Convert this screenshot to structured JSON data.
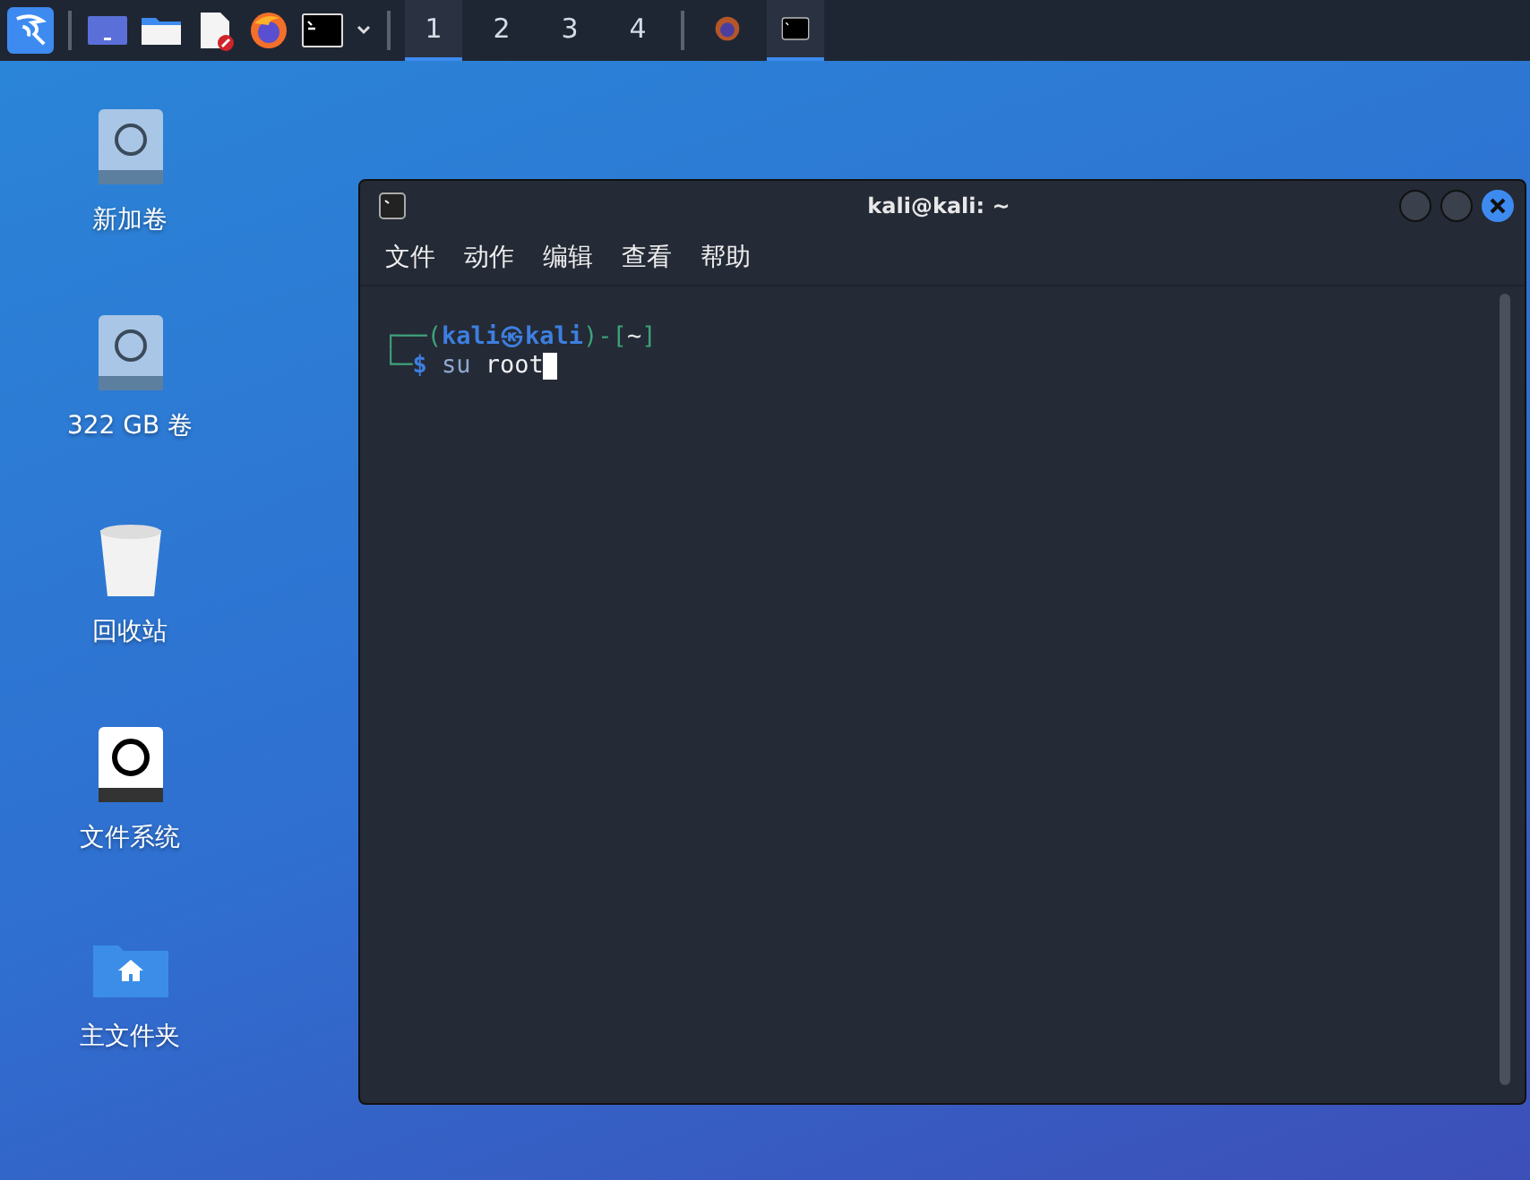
{
  "taskbar": {
    "launchers": [
      {
        "kind": "menu"
      },
      {
        "kind": "desktop"
      },
      {
        "kind": "folder"
      },
      {
        "kind": "editor"
      },
      {
        "kind": "browser"
      },
      {
        "kind": "terminal"
      }
    ],
    "workspaces": [
      {
        "label": "1",
        "selected": true
      },
      {
        "label": "2",
        "selected": false
      },
      {
        "label": "3",
        "selected": false
      },
      {
        "label": "4",
        "selected": false
      }
    ],
    "tasks": [
      {
        "kind": "browser",
        "selected": false
      },
      {
        "kind": "terminal",
        "selected": true
      }
    ]
  },
  "desktop_icons": [
    {
      "label": "新加卷",
      "kind": "drive"
    },
    {
      "label": "322 GB 卷",
      "kind": "drive"
    },
    {
      "label": "回收站",
      "kind": "trash"
    },
    {
      "label": "文件系统",
      "kind": "root"
    },
    {
      "label": "主文件夹",
      "kind": "home"
    }
  ],
  "window": {
    "title": "kali@kali: ~",
    "menu": [
      "文件",
      "动作",
      "编辑",
      "查看",
      "帮助"
    ],
    "lines": [
      [
        {
          "text": "┌──(",
          "kind": "frame"
        },
        {
          "text": "kali㉿kali",
          "kind": "user"
        },
        {
          "text": ")-[",
          "kind": "frame"
        },
        {
          "text": "~",
          "kind": "path"
        },
        {
          "text": "]",
          "kind": "frame"
        }
      ],
      [
        {
          "text": "└─",
          "kind": "frame"
        },
        {
          "text": "$",
          "kind": "user"
        },
        {
          "text": " su",
          "kind": "cmd"
        },
        {
          "text": " root",
          "kind": "arg"
        }
      ]
    ]
  }
}
